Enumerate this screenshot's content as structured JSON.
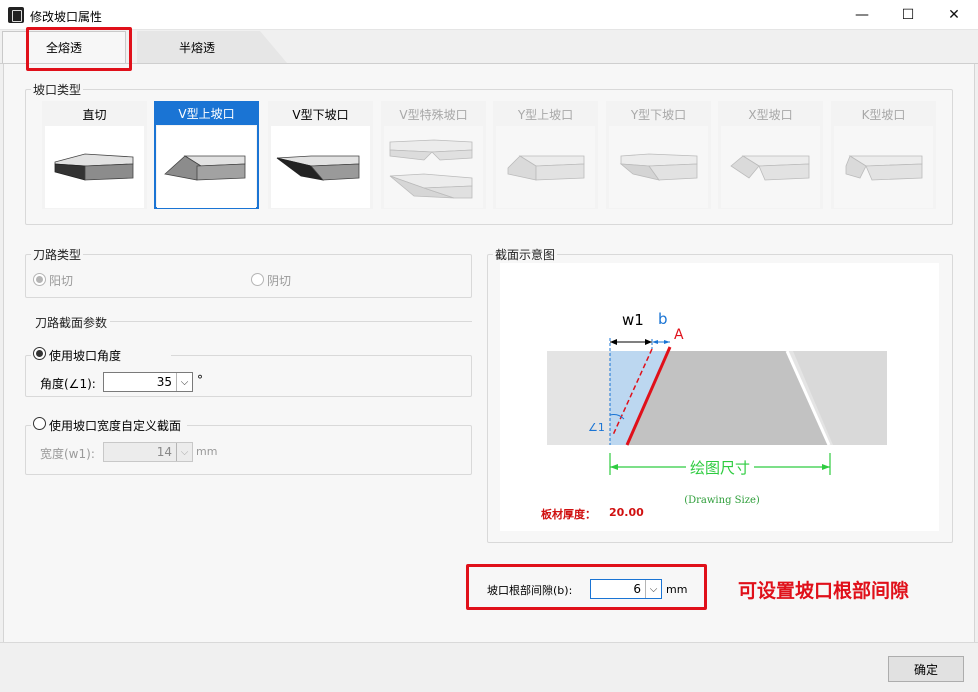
{
  "window": {
    "title": "修改坡口属性",
    "minimize_glyph": "—",
    "maximize_glyph": "☐",
    "close_glyph": "✕"
  },
  "tabs": [
    {
      "label": "全熔透",
      "active": true
    },
    {
      "label": "半熔透",
      "active": false
    }
  ],
  "groove_type": {
    "title": "坡口类型",
    "items": [
      {
        "label": "直切",
        "state": "enabled",
        "icon": "straight-cut-icon"
      },
      {
        "label": "V型上坡口",
        "state": "selected",
        "icon": "v-upper-bevel-icon"
      },
      {
        "label": "V型下坡口",
        "state": "enabled",
        "icon": "v-lower-bevel-icon"
      },
      {
        "label": "V型特殊坡口",
        "state": "disabled",
        "icon": "v-special-bevel-icon"
      },
      {
        "label": "Y型上坡口",
        "state": "disabled",
        "icon": "y-upper-bevel-icon"
      },
      {
        "label": "Y型下坡口",
        "state": "disabled",
        "icon": "y-lower-bevel-icon"
      },
      {
        "label": "X型坡口",
        "state": "disabled",
        "icon": "x-bevel-icon"
      },
      {
        "label": "K型坡口",
        "state": "disabled",
        "icon": "k-bevel-icon"
      }
    ]
  },
  "tool_path": {
    "title": "刀路类型",
    "options": [
      {
        "label": "阳切",
        "checked": true,
        "disabled": true
      },
      {
        "label": "阴切",
        "checked": false,
        "disabled": true
      }
    ]
  },
  "section_params": {
    "title": "刀路截面参数",
    "use_angle": {
      "label": "使用坡口角度",
      "checked": true
    },
    "angle": {
      "label": "角度(∠1):",
      "value": "35",
      "unit": "°"
    },
    "use_width": {
      "label": "使用坡口宽度自定义截面",
      "checked": false
    },
    "width": {
      "label": "宽度(w1):",
      "value": "14",
      "unit": "mm"
    }
  },
  "diagram": {
    "title": "截面示意图",
    "w1": "w1",
    "b": "b",
    "point_a": "A",
    "angle_label": "∠1",
    "drawing_size": "绘图尺寸",
    "drawing_size_en": "(Drawing Size)",
    "thickness_label": "板材厚度：",
    "thickness_value": "20.00"
  },
  "root_gap": {
    "label": "坡口根部间隙(b):",
    "value": "6",
    "unit": "mm"
  },
  "annotation": "可设置坡口根部间隙",
  "ok_button": "确定",
  "colors": {
    "accent": "#1a74d4",
    "highlight": "#e0101a",
    "dimension": "#2ecc40"
  }
}
